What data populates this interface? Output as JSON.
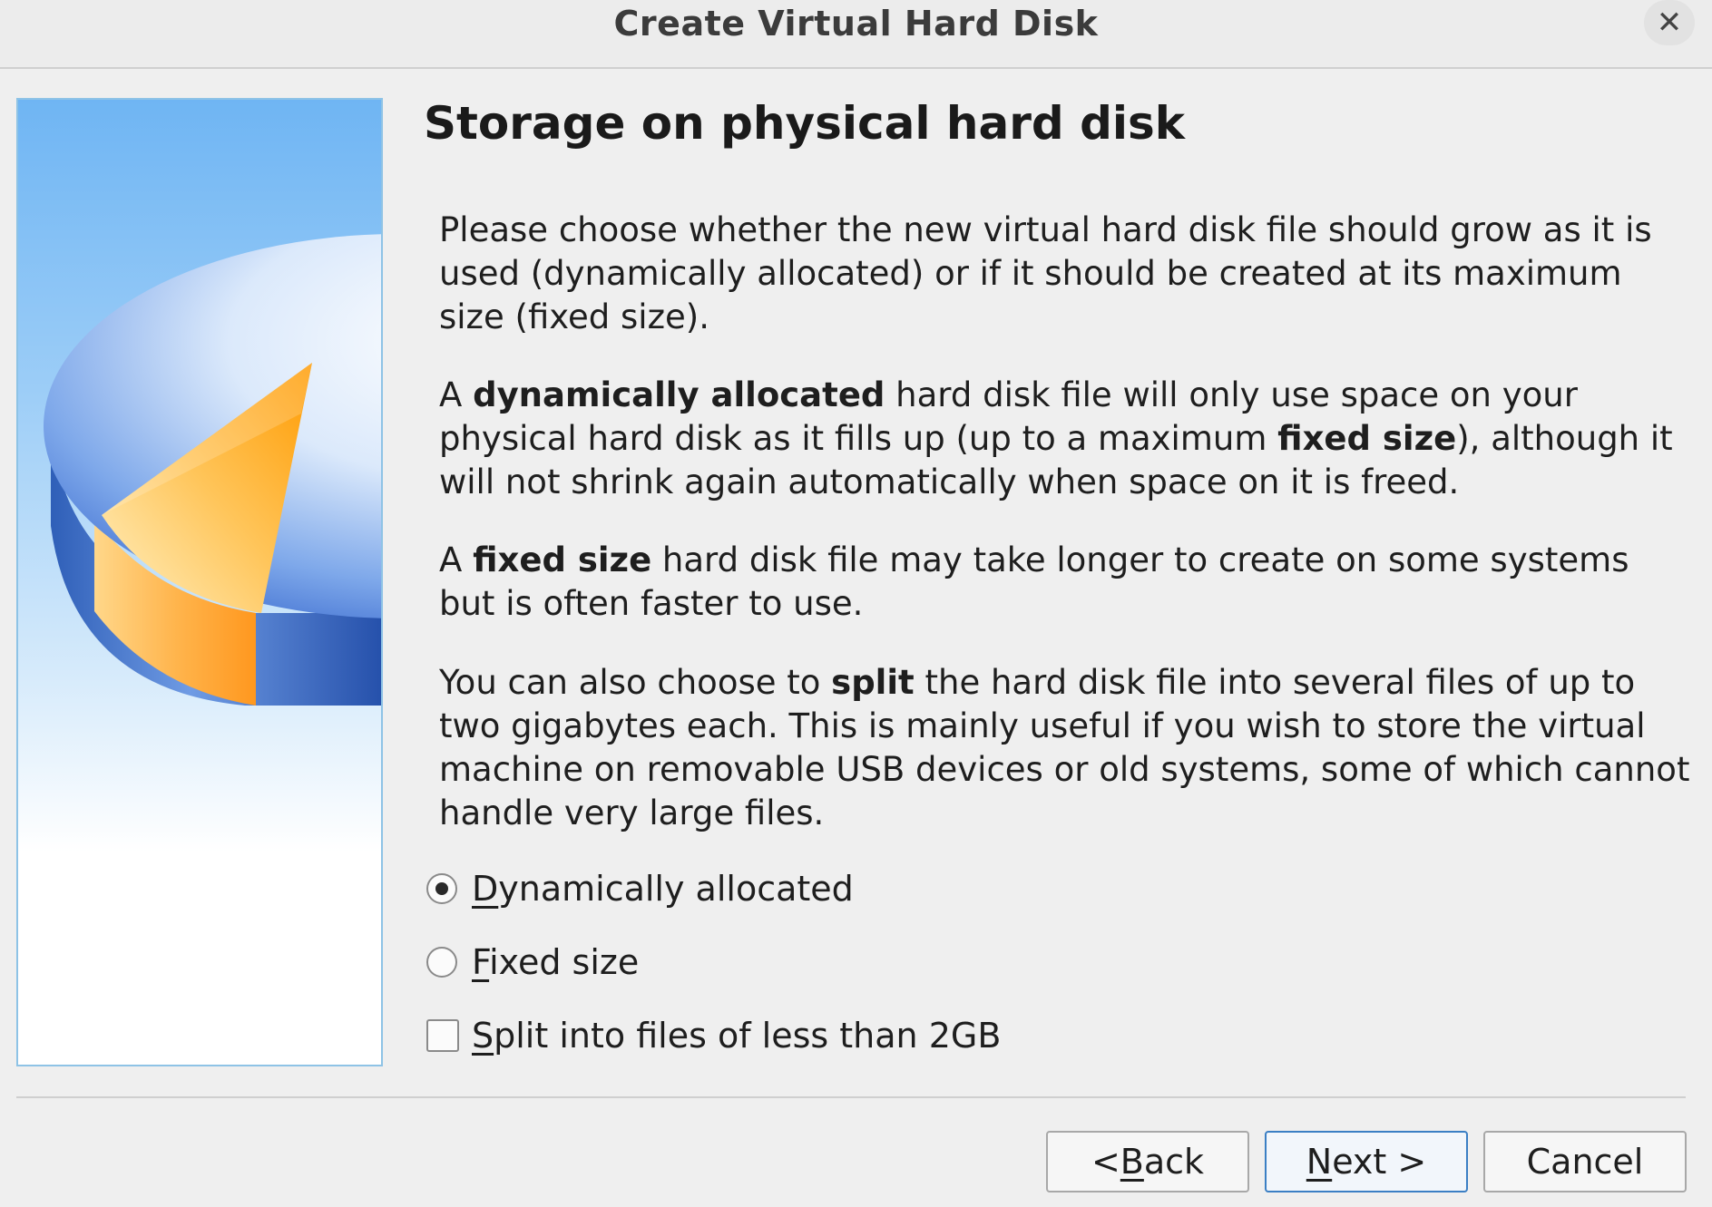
{
  "window": {
    "title": "Create Virtual Hard Disk",
    "close_glyph": "✕"
  },
  "page": {
    "heading": "Storage on physical hard disk",
    "paragraphs": [
      [
        {
          "t": "Please choose whether the new virtual hard disk file should grow as it is used (dynamically allocated) or if it should be created at its maximum size (fixed size).",
          "b": false
        }
      ],
      [
        {
          "t": "A ",
          "b": false
        },
        {
          "t": "dynamically allocated",
          "b": true
        },
        {
          "t": " hard disk file will only use space on your physical hard disk as it fills up (up to a maximum ",
          "b": false
        },
        {
          "t": "fixed size",
          "b": true
        },
        {
          "t": "), although it will not shrink again automatically when space on it is freed.",
          "b": false
        }
      ],
      [
        {
          "t": "A ",
          "b": false
        },
        {
          "t": "fixed size",
          "b": true
        },
        {
          "t": " hard disk file may take longer to create on some systems but is often faster to use.",
          "b": false
        }
      ],
      [
        {
          "t": "You can also choose to ",
          "b": false
        },
        {
          "t": "split",
          "b": true
        },
        {
          "t": " the hard disk file into several files of up to two gigabytes each. This is mainly useful if you wish to store the virtual machine on removable USB devices or old systems, some of which cannot handle very large files.",
          "b": false
        }
      ]
    ]
  },
  "options": {
    "dynamic": {
      "mnemonic": "D",
      "rest": "ynamically allocated",
      "selected": true
    },
    "fixed": {
      "mnemonic": "F",
      "rest": "ixed size",
      "selected": false
    },
    "split": {
      "mnemonic": "S",
      "rest": "plit into files of less than 2GB",
      "checked": false
    }
  },
  "buttons": {
    "back": {
      "pre": "< ",
      "mnemonic": "B",
      "rest": "ack"
    },
    "next": {
      "pre": "",
      "mnemonic": "N",
      "rest": "ext >"
    },
    "cancel": {
      "label": "Cancel"
    }
  },
  "colors": {
    "accent": "#3b7fc4",
    "disk_blue": "#4a7fd0",
    "wedge_orange": "#ffa21a"
  },
  "icons": {
    "side_image": "hard-disk-pie-icon",
    "close": "close-icon"
  }
}
